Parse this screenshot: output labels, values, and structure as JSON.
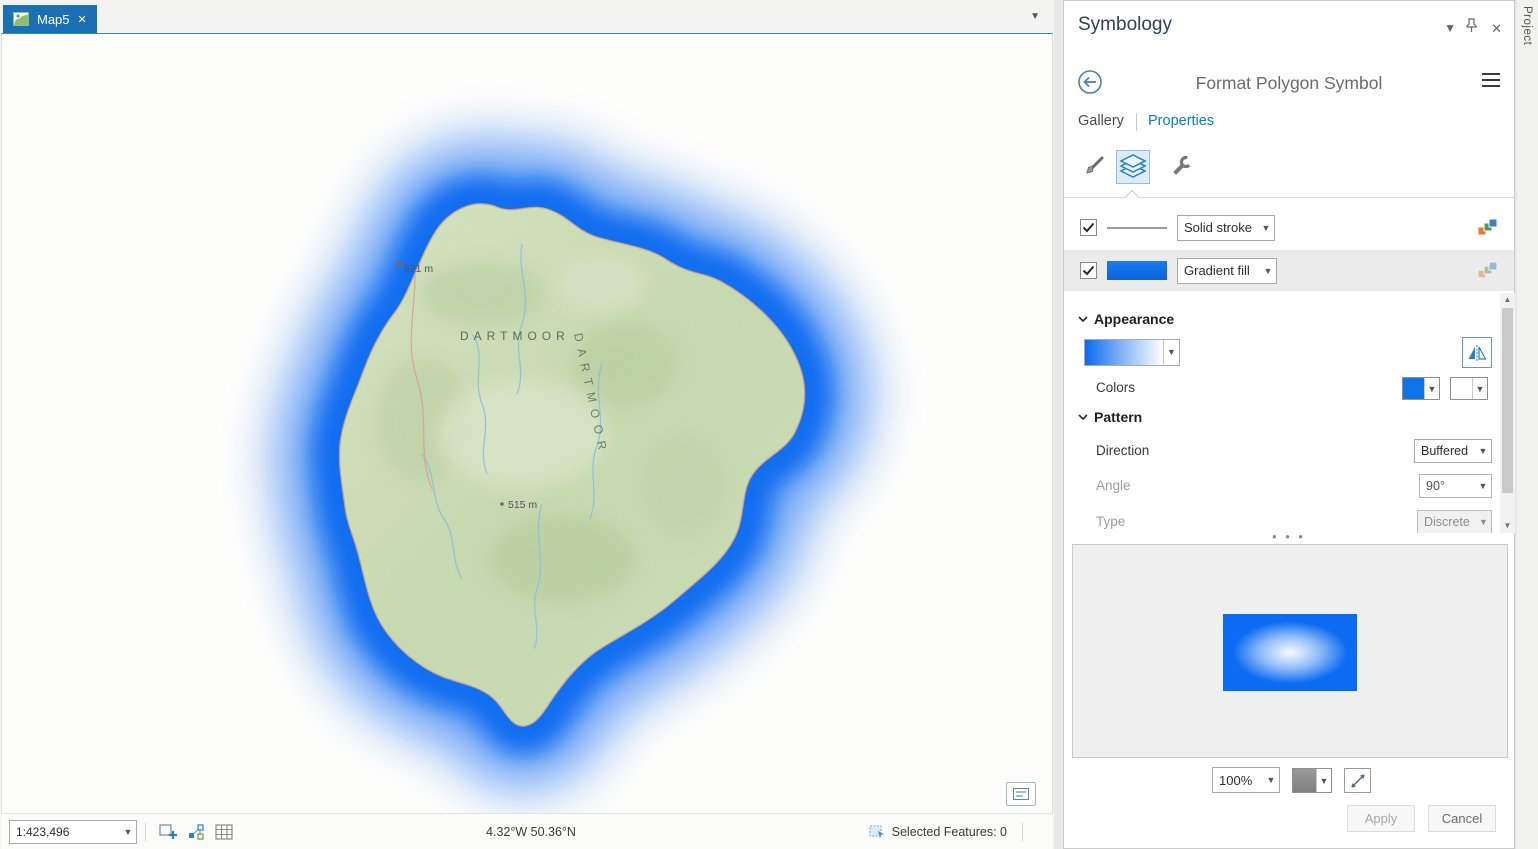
{
  "tabstrip": {
    "map_tab_label": "Map5"
  },
  "project_tab": {
    "label": "Project"
  },
  "map": {
    "region_label": "DARTMOOR",
    "region_label_rotated": "DARTMOOR",
    "elevation_1": "621 m",
    "elevation_2": "515 m"
  },
  "statusbar": {
    "scale": "1:423,496",
    "coordinates": "4.32°W 50.36°N",
    "selected_features": "Selected Features: 0"
  },
  "panel": {
    "title": "Symbology",
    "heading": "Format Polygon Symbol",
    "tabs": {
      "gallery": "Gallery",
      "properties": "Properties"
    },
    "layers": [
      {
        "label": "Solid stroke"
      },
      {
        "label": "Gradient fill"
      }
    ],
    "sections": {
      "appearance": "Appearance",
      "pattern": "Pattern"
    },
    "fields": {
      "colors_label": "Colors",
      "direction_label": "Direction",
      "direction_value": "Buffered",
      "angle_label": "Angle",
      "angle_value": "90°",
      "type_label": "Type",
      "type_value": "Discrete"
    },
    "preview": {
      "zoom": "100%"
    },
    "actions": {
      "apply": "Apply",
      "cancel": "Cancel"
    }
  }
}
